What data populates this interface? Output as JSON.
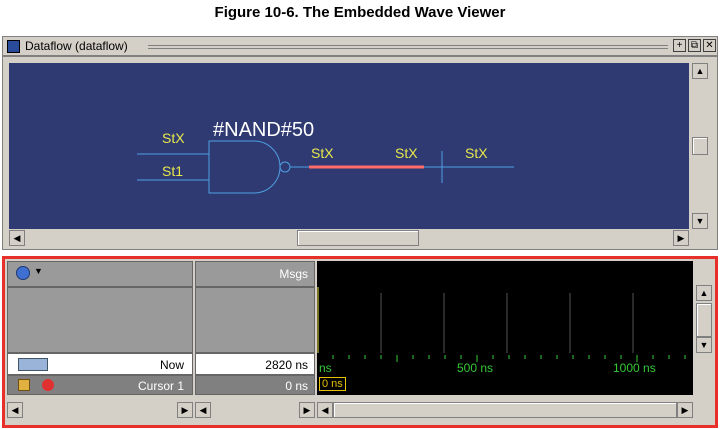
{
  "caption": "Figure 10-6. The Embedded Wave Viewer",
  "window": {
    "title": "Dataflow (dataflow)",
    "buttons": [
      "+",
      "⧉",
      "✕"
    ]
  },
  "dataflow": {
    "instance_label": "#NAND#50",
    "input_a": "StX",
    "input_b": "St1",
    "output_1": "StX",
    "output_2": "StX",
    "output_3": "StX"
  },
  "wave": {
    "msgs_header": "Msgs",
    "now_label": "Now",
    "now_value": "2820 ns",
    "cursor_label": "Cursor 1",
    "cursor_value": "0 ns",
    "cursor_flag": "0 ns",
    "time_ticks": [
      "ns",
      "500 ns",
      "1000 ns"
    ]
  },
  "colors": {
    "canvas": "#2f3a73",
    "signal_text": "#e8e84a",
    "wire": "#4f9fe0",
    "highlight_wire": "#ff6a6a",
    "time_green": "#36c836",
    "frame_red": "#e8302a"
  },
  "icons": {
    "title": "dataflow-window-icon",
    "wave_toolbar": "globe-dropdown-icon",
    "now_row": "signal-add-icon",
    "cursor_row": "cursor-lock-delete-icon"
  }
}
